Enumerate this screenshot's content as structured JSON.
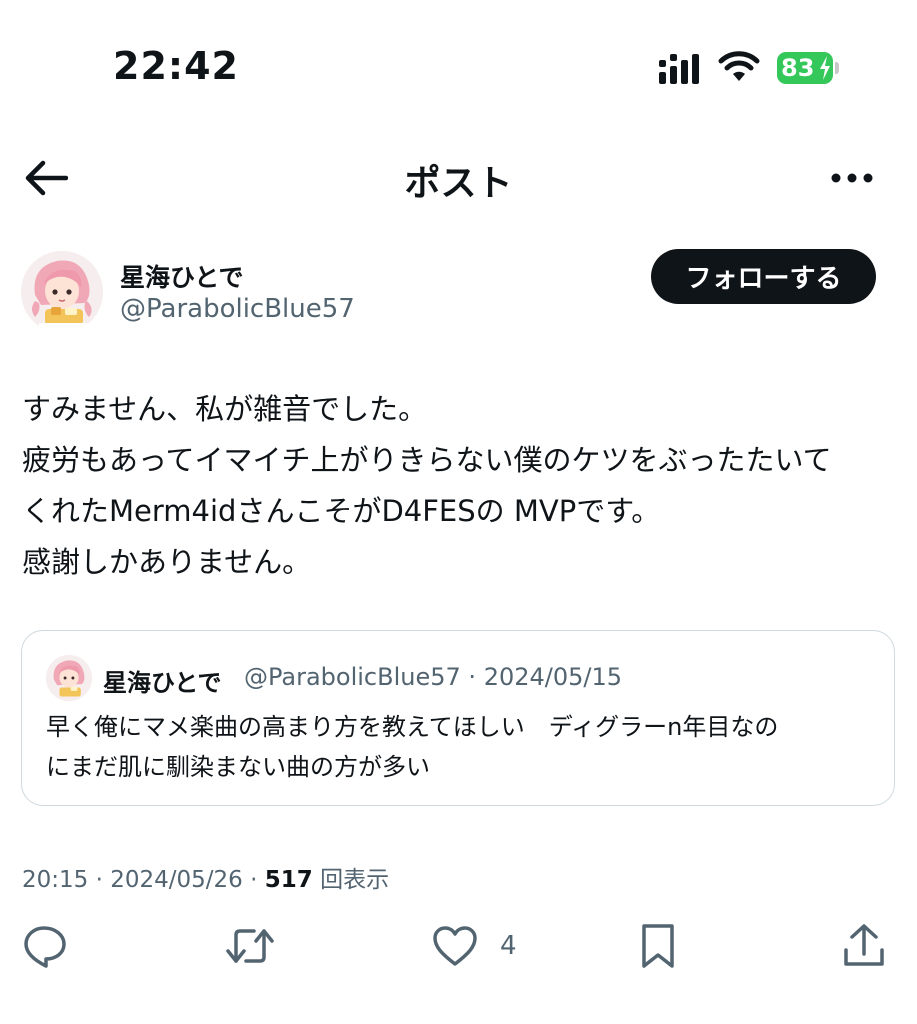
{
  "status_bar": {
    "time": "22:42",
    "battery": "83",
    "icons": [
      "signal-icon",
      "wifi-icon",
      "battery-icon",
      "charging-bolt-icon"
    ]
  },
  "header": {
    "title": "ポスト",
    "back_icon": "arrow-left-icon",
    "more_icon": "more-horizontal-icon"
  },
  "author": {
    "name": "星海ひとで",
    "handle": "@ParabolicBlue57",
    "follow_label": "フォローする"
  },
  "post": {
    "lines": [
      "すみません、私が雑音でした。",
      "疲労もあってイマイチ上がりきらない僕のケツをぶったたいて",
      "くれたMerm4idさんこそがD4FESの MVPです。",
      "感謝しかありません。"
    ],
    "time": "20:15",
    "date": "2024/05/26",
    "views": "517",
    "views_label": "回表示"
  },
  "quote": {
    "name": "星海ひとで",
    "handle": "@ParabolicBlue57",
    "date": "2024/05/15",
    "lines": [
      "早く俺にマメ楽曲の高まり方を教えてほしい　ディグラーn年目なの",
      "にまだ肌に馴染まない曲の方が多い"
    ]
  },
  "actions": {
    "reply_icon": "reply-icon",
    "retweet_icon": "retweet-icon",
    "like_icon": "heart-icon",
    "like_count": "4",
    "bookmark_icon": "bookmark-icon",
    "share_icon": "share-icon"
  },
  "colors": {
    "text": "#0f1419",
    "secondary": "#536471",
    "border": "#cfd9de",
    "battery": "#34c759"
  }
}
